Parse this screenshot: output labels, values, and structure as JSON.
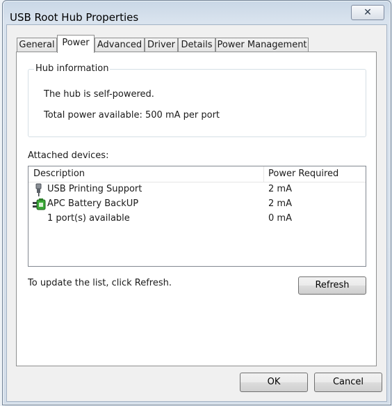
{
  "window": {
    "title": "USB Root Hub Properties",
    "close_glyph": "✕"
  },
  "tabs": [
    {
      "label": "General"
    },
    {
      "label": "Power",
      "active": true
    },
    {
      "label": "Advanced"
    },
    {
      "label": "Driver"
    },
    {
      "label": "Details"
    },
    {
      "label": "Power Management"
    }
  ],
  "hub_info": {
    "group_title": "Hub information",
    "self_powered": "The hub is self-powered.",
    "total_power": "Total power available:  500 mA per port"
  },
  "attached": {
    "label": "Attached devices:",
    "columns": {
      "description": "Description",
      "power": "Power Required"
    },
    "rows": [
      {
        "description": "USB Printing Support",
        "power": "2 mA",
        "icon": "usb-plug-icon"
      },
      {
        "description": "APC Battery BackUP",
        "power": "2 mA",
        "icon": "battery-device-icon"
      },
      {
        "description": "1 port(s) available",
        "power": "0 mA",
        "icon": ""
      }
    ]
  },
  "update_text": "To update the list, click Refresh.",
  "buttons": {
    "refresh": "Refresh",
    "ok": "OK",
    "cancel": "Cancel"
  },
  "colors": {
    "window_frame": "#c9d7e6",
    "panel": "#ffffff",
    "client": "#f0f0f0"
  }
}
